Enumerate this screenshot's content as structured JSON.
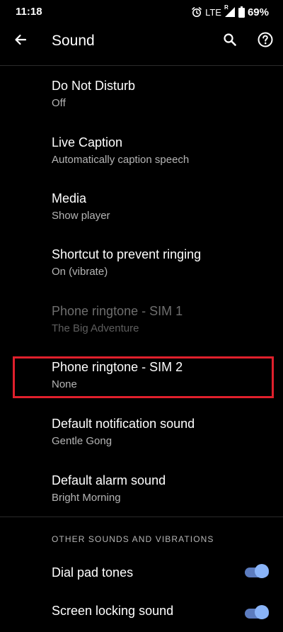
{
  "status_bar": {
    "time": "11:18",
    "network": "LTE",
    "signal_badge": "R",
    "battery": "69%",
    "icons": [
      "alarm-icon",
      "signal-icon",
      "battery-icon"
    ]
  },
  "app_bar": {
    "title": "Sound",
    "icons": [
      "back-arrow-icon",
      "search-icon",
      "help-icon"
    ]
  },
  "preferences": [
    {
      "title": "Do Not Disturb",
      "summary": "Off",
      "enabled": true
    },
    {
      "title": "Live Caption",
      "summary": "Automatically caption speech",
      "enabled": true
    },
    {
      "title": "Media",
      "summary": "Show player",
      "enabled": true
    },
    {
      "title": "Shortcut to prevent ringing",
      "summary": "On (vibrate)",
      "enabled": true
    },
    {
      "title": "Phone ringtone - SIM 1",
      "summary": "The Big Adventure",
      "enabled": false
    },
    {
      "title": "Phone ringtone - SIM 2",
      "summary": "None",
      "enabled": true,
      "highlighted": true
    },
    {
      "title": "Default notification sound",
      "summary": "Gentle Gong",
      "enabled": true
    },
    {
      "title": "Default alarm sound",
      "summary": "Bright Morning",
      "enabled": true
    }
  ],
  "other_section": {
    "header": "OTHER SOUNDS AND VIBRATIONS",
    "items": [
      {
        "title": "Dial pad tones",
        "checked": true
      },
      {
        "title": "Screen locking sound",
        "checked": true
      }
    ]
  },
  "colors": {
    "background": "#000000",
    "text_primary": "#ffffff",
    "text_secondary": "#b5b5b5",
    "text_disabled": "#6e6e6e",
    "highlight": "#e0202c",
    "switch_thumb": "#8ab4f8",
    "switch_track": "#5c7cbf"
  }
}
